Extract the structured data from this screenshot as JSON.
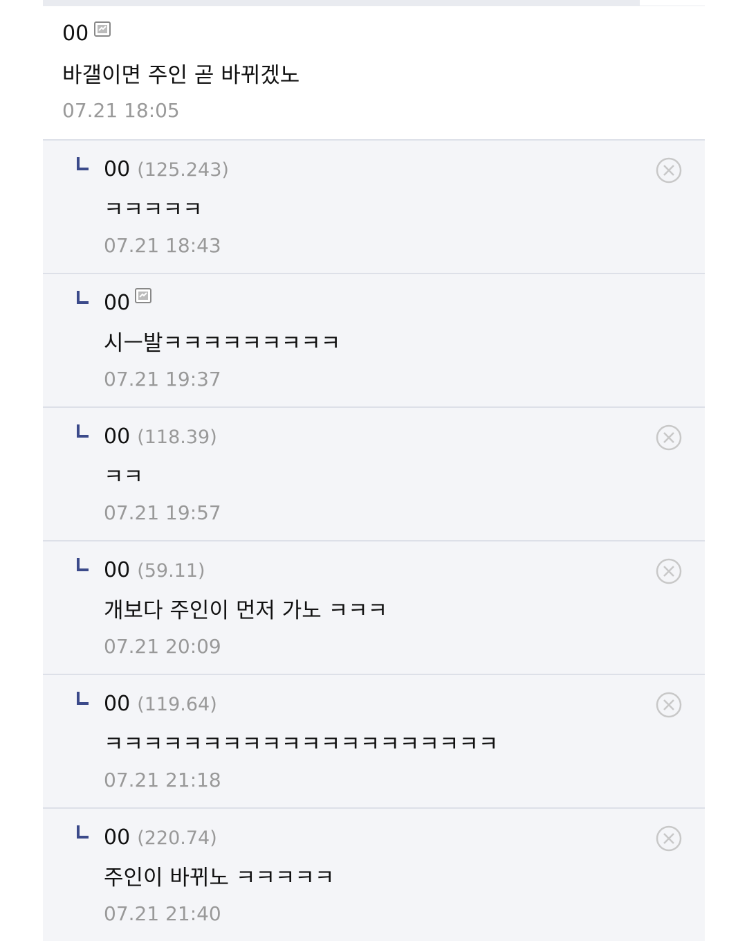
{
  "main_comment": {
    "nickname": "00",
    "text": "바갤이면 주인 곧 바뀌겠노",
    "date": "07.21 18:05",
    "icon": "gallery-member-icon"
  },
  "replies": [
    {
      "nickname": "00",
      "ip": "(125.243)",
      "text": "ㅋㅋㅋㅋㅋ",
      "date": "07.21 18:43",
      "deletable": true
    },
    {
      "nickname": "00",
      "ip": "",
      "text": "시ㅡ발ㅋㅋㅋㅋㅋㅋㅋㅋㅋ",
      "date": "07.21 19:37",
      "deletable": false,
      "icon": "gallery-member-icon"
    },
    {
      "nickname": "00",
      "ip": "(118.39)",
      "text": "ㅋㅋ",
      "date": "07.21 19:57",
      "deletable": true
    },
    {
      "nickname": "00",
      "ip": "(59.11)",
      "text": "개보다 주인이 먼저 가노 ㅋㅋㅋ",
      "date": "07.21 20:09",
      "deletable": true
    },
    {
      "nickname": "00",
      "ip": "(119.64)",
      "text": "ㅋㅋㅋㅋㅋㅋㅋㅋㅋㅋㅋㅋㅋㅋㅋㅋㅋㅋㅋㅋ",
      "date": "07.21 21:18",
      "deletable": true
    },
    {
      "nickname": "00",
      "ip": "(220.74)",
      "text": "주인이 바뀌노 ㅋㅋㅋㅋㅋ",
      "date": "07.21 21:40",
      "deletable": true
    }
  ],
  "colors": {
    "reply_bg": "#f4f5f8",
    "divider": "#dde0e8",
    "meta_text": "#999999",
    "reply_arrow": "#3b4a8a",
    "delete_icon": "#c8c8c8"
  }
}
